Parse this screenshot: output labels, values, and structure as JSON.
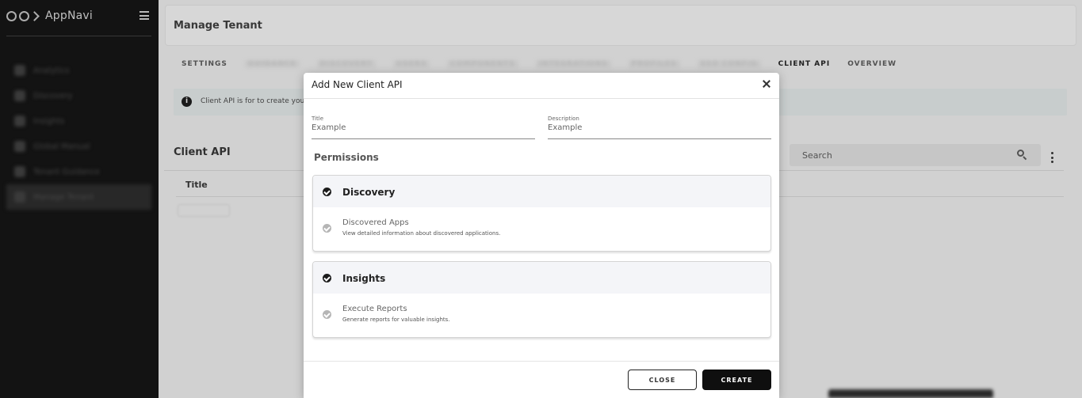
{
  "sidebar": {
    "brand": "AppNavi",
    "items": [
      {
        "label": "Analytics"
      },
      {
        "label": "Discovery"
      },
      {
        "label": "Insights"
      },
      {
        "label": "Global Manual"
      },
      {
        "label": "Tenant Guidance"
      },
      {
        "label": "Manage Tenant"
      }
    ]
  },
  "page": {
    "title": "Manage Tenant",
    "tabs": [
      {
        "label": "SETTINGS",
        "state": "normal"
      },
      {
        "label": "GUIDANCE",
        "state": "blurred"
      },
      {
        "label": "DISCOVERY",
        "state": "blurred"
      },
      {
        "label": "USERS",
        "state": "blurred"
      },
      {
        "label": "COMPONENTS",
        "state": "blurred"
      },
      {
        "label": "INTEGRATIONS",
        "state": "blurred"
      },
      {
        "label": "PROFILES",
        "state": "blurred"
      },
      {
        "label": "SSO CONFIG",
        "state": "blurred"
      },
      {
        "label": "CLIENT API",
        "state": "active"
      },
      {
        "label": "OVERVIEW",
        "state": "normal"
      }
    ],
    "info_text": "Client API is for to create your",
    "section_title": "Client API",
    "search_placeholder": "Search",
    "table_header": "Title"
  },
  "modal": {
    "title": "Add New Client API",
    "fields": {
      "title": {
        "label": "Title",
        "placeholder": "Example"
      },
      "description": {
        "label": "Description",
        "placeholder": "Example"
      }
    },
    "permissions_title": "Permissions",
    "permissions": [
      {
        "name": "Discovery",
        "sub_name": "Discovered Apps",
        "sub_desc": "View detailed information about discovered applications."
      },
      {
        "name": "Insights",
        "sub_name": "Execute Reports",
        "sub_desc": "Generate reports for valuable insights."
      }
    ],
    "close_label": "CLOSE",
    "create_label": "CREATE"
  }
}
